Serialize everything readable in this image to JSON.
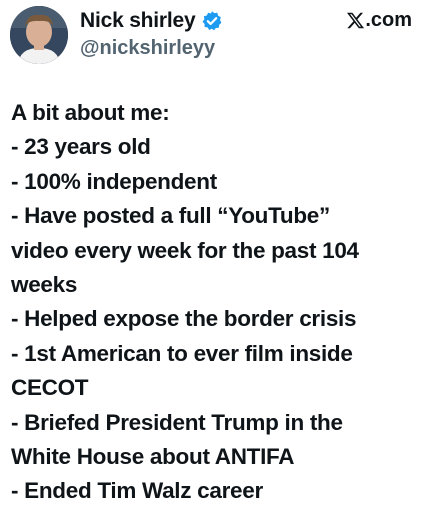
{
  "author": {
    "display_name": "Nick shirley",
    "handle": "@nickshirleyy",
    "verified_icon": "verified-badge-icon"
  },
  "source": {
    "icon": "x-logo-icon",
    "label": ".com"
  },
  "post": {
    "lines": [
      "A bit about me:",
      "- 23 years old",
      "- 100% independent",
      "- Have posted a full “YouTube”",
      "video every week for the past 104",
      "weeks",
      "- Helped expose the border crisis",
      "- 1st American to ever film inside",
      "CECOT",
      "- Briefed President Trump in the",
      "White House about ANTIFA",
      "- Ended Tim Walz career"
    ]
  },
  "colors": {
    "text": "#0f1419",
    "secondary_text": "#536471",
    "verified": "#1d9bf0",
    "background": "#ffffff"
  }
}
